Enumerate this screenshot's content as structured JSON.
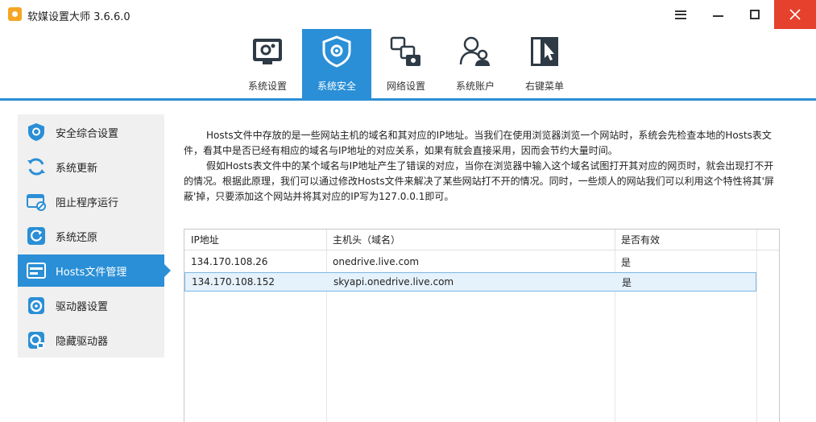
{
  "window": {
    "title": "软媒设置大师 3.6.6.0"
  },
  "toolbar": {
    "items": [
      {
        "label": "系统设置",
        "icon": "monitor-gear-icon"
      },
      {
        "label": "系统安全",
        "icon": "shield-gear-icon",
        "active": true
      },
      {
        "label": "网络设置",
        "icon": "network-icon"
      },
      {
        "label": "系统账户",
        "icon": "users-icon"
      },
      {
        "label": "右键菜单",
        "icon": "context-menu-icon"
      }
    ]
  },
  "sidebar": {
    "items": [
      {
        "label": "安全综合设置",
        "icon": "shield-icon"
      },
      {
        "label": "系统更新",
        "icon": "refresh-icon"
      },
      {
        "label": "阻止程序运行",
        "icon": "block-program-icon"
      },
      {
        "label": "系统还原",
        "icon": "restore-icon"
      },
      {
        "label": "Hosts文件管理",
        "icon": "hosts-icon",
        "active": true
      },
      {
        "label": "驱动器设置",
        "icon": "drive-icon"
      },
      {
        "label": "隐藏驱动器",
        "icon": "hidden-drive-icon"
      }
    ]
  },
  "description": {
    "paragraph1": "Hosts文件中存放的是一些网站主机的域名和其对应的IP地址。当我们在使用浏览器浏览一个网站时，系统会先检查本地的Hosts表文件，看其中是否已经有相应的域名与IP地址的对应关系，如果有就会直接采用，因而会节约大量时间。",
    "paragraph2": "假如Hosts表文件中的某个域名与IP地址产生了错误的对应，当你在浏览器中输入这个域名试图打开其对应的网页时，就会出现打不开的情况。根据此原理，我们可以通过修改Hosts文件来解决了某些网站打不开的情况。同时，一些烦人的网站我们可以利用这个特性将其'屏蔽'掉，只要添加这个网站并将其对应的IP写为127.0.0.1即可。"
  },
  "hosts_table": {
    "columns": [
      "IP地址",
      "主机头（域名）",
      "是否有效"
    ],
    "rows": [
      {
        "ip": "134.170.108.26",
        "host": "onedrive.live.com",
        "valid": "是"
      },
      {
        "ip": "134.170.108.152",
        "host": "skyapi.onedrive.live.com",
        "valid": "是",
        "selected": true
      }
    ]
  },
  "colors": {
    "accent": "#2a8fd6",
    "close": "#e5412d",
    "sidebar_bg": "#f0f0f0"
  }
}
